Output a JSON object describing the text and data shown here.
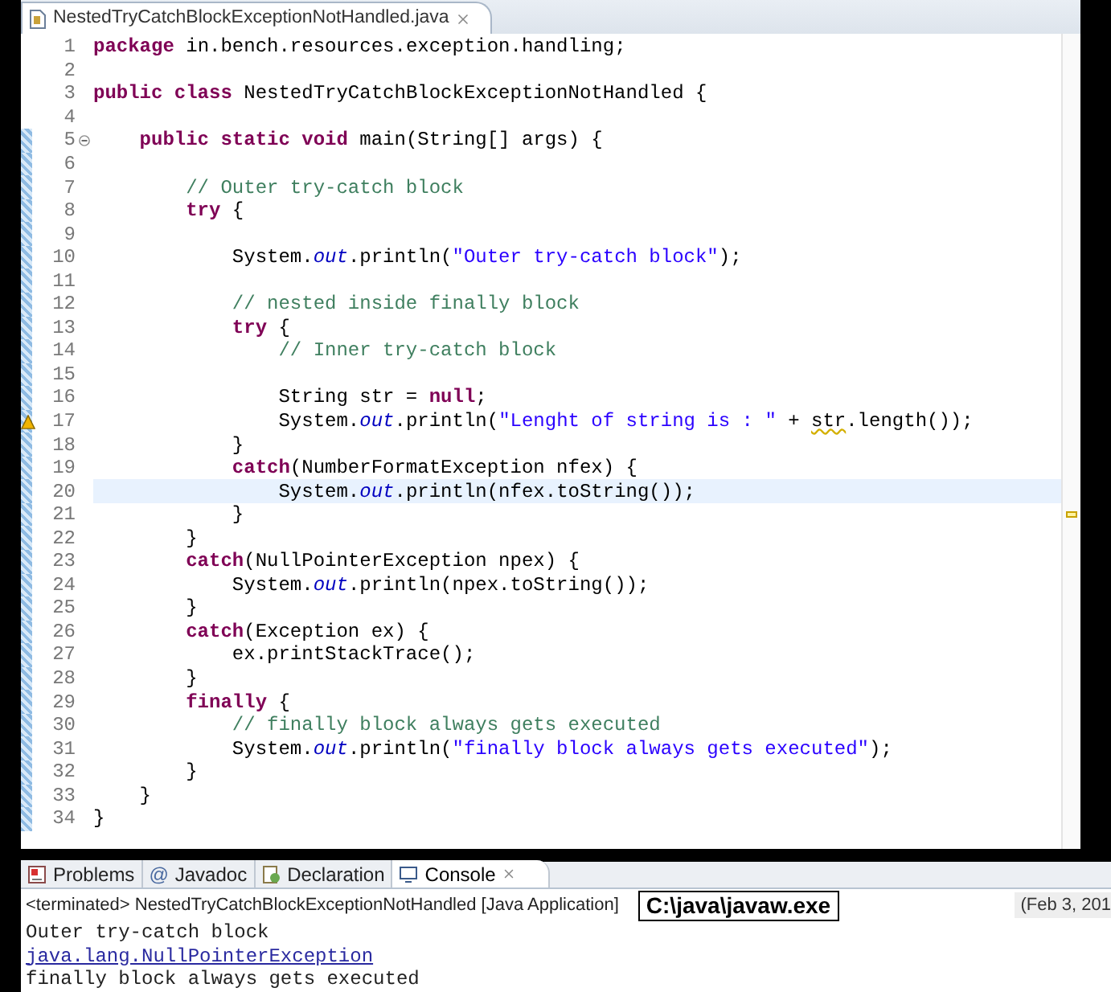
{
  "editor": {
    "tab": {
      "title": "NestedTryCatchBlockExceptionNotHandled.java"
    },
    "lines": [
      {
        "number": "1",
        "changed": false,
        "foldable": false,
        "warning": false,
        "current": false,
        "tokens": [
          {
            "kind": "keyword",
            "text": "package"
          },
          {
            "kind": "plain",
            "text": " in.bench.resources.exception.handling;"
          }
        ]
      },
      {
        "number": "2",
        "changed": false,
        "foldable": false,
        "warning": false,
        "current": false
      },
      {
        "number": "3",
        "changed": false,
        "foldable": false,
        "warning": false,
        "current": false,
        "tokens": [
          {
            "kind": "keyword",
            "text": "public class"
          },
          {
            "kind": "plain",
            "text": " NestedTryCatchBlockExceptionNotHandled {"
          }
        ]
      },
      {
        "number": "4",
        "changed": false,
        "foldable": false,
        "warning": false,
        "current": false
      },
      {
        "number": "5",
        "changed": true,
        "foldable": true,
        "warning": false,
        "current": false,
        "tokens": [
          {
            "kind": "keyword",
            "text": "    public static void"
          },
          {
            "kind": "plain",
            "text": " main(String[] args) {"
          }
        ]
      },
      {
        "number": "6",
        "changed": true,
        "foldable": false,
        "warning": false,
        "current": false
      },
      {
        "number": "7",
        "changed": true,
        "foldable": false,
        "warning": false,
        "current": false,
        "tokens": [
          {
            "kind": "comment",
            "text": "        // Outer try-catch block"
          }
        ]
      },
      {
        "number": "8",
        "changed": true,
        "foldable": false,
        "warning": false,
        "current": false,
        "tokens": [
          {
            "kind": "keyword",
            "text": "        try"
          },
          {
            "kind": "plain",
            "text": " {"
          }
        ]
      },
      {
        "number": "9",
        "changed": true,
        "foldable": false,
        "warning": false,
        "current": false
      },
      {
        "number": "10",
        "changed": true,
        "foldable": false,
        "warning": false,
        "current": false,
        "tokens": [
          {
            "kind": "plain",
            "text": "            System."
          },
          {
            "kind": "field",
            "text": "out"
          },
          {
            "kind": "plain",
            "text": ".println("
          },
          {
            "kind": "string",
            "text": "\"Outer try-catch block\""
          },
          {
            "kind": "plain",
            "text": ");"
          }
        ]
      },
      {
        "number": "11",
        "changed": true,
        "foldable": false,
        "warning": false,
        "current": false
      },
      {
        "number": "12",
        "changed": true,
        "foldable": false,
        "warning": false,
        "current": false,
        "tokens": [
          {
            "kind": "comment",
            "text": "            // nested inside finally block"
          }
        ]
      },
      {
        "number": "13",
        "changed": true,
        "foldable": false,
        "warning": false,
        "current": false,
        "tokens": [
          {
            "kind": "keyword",
            "text": "            try"
          },
          {
            "kind": "plain",
            "text": " {"
          }
        ]
      },
      {
        "number": "14",
        "changed": true,
        "foldable": false,
        "warning": false,
        "current": false,
        "tokens": [
          {
            "kind": "comment",
            "text": "                // Inner try-catch block"
          }
        ]
      },
      {
        "number": "15",
        "changed": true,
        "foldable": false,
        "warning": false,
        "current": false
      },
      {
        "number": "16",
        "changed": true,
        "foldable": false,
        "warning": false,
        "current": false,
        "tokens": [
          {
            "kind": "plain",
            "text": "                String str = "
          },
          {
            "kind": "keyword",
            "text": "null"
          },
          {
            "kind": "plain",
            "text": ";"
          }
        ]
      },
      {
        "number": "17",
        "changed": true,
        "foldable": false,
        "warning": true,
        "current": false,
        "tokens": [
          {
            "kind": "plain",
            "text": "                System."
          },
          {
            "kind": "field",
            "text": "out"
          },
          {
            "kind": "plain",
            "text": ".println("
          },
          {
            "kind": "string",
            "text": "\"Lenght of string is : \""
          },
          {
            "kind": "plain",
            "text": " + "
          },
          {
            "kind": "squiggly",
            "text": "str"
          },
          {
            "kind": "plain",
            "text": ".length());"
          }
        ]
      },
      {
        "number": "18",
        "changed": true,
        "foldable": false,
        "warning": false,
        "current": false,
        "tokens": [
          {
            "kind": "plain",
            "text": "            }"
          }
        ]
      },
      {
        "number": "19",
        "changed": true,
        "foldable": false,
        "warning": false,
        "current": false,
        "tokens": [
          {
            "kind": "keyword",
            "text": "            catch"
          },
          {
            "kind": "plain",
            "text": "(NumberFormatException nfex) {"
          }
        ]
      },
      {
        "number": "20",
        "changed": true,
        "foldable": false,
        "warning": false,
        "current": true,
        "tokens": [
          {
            "kind": "plain",
            "text": "                System."
          },
          {
            "kind": "field",
            "text": "out"
          },
          {
            "kind": "plain",
            "text": ".println(nfex.toString());"
          }
        ]
      },
      {
        "number": "21",
        "changed": true,
        "foldable": false,
        "warning": false,
        "current": false,
        "tokens": [
          {
            "kind": "plain",
            "text": "            }"
          }
        ]
      },
      {
        "number": "22",
        "changed": true,
        "foldable": false,
        "warning": false,
        "current": false,
        "tokens": [
          {
            "kind": "plain",
            "text": "        }"
          }
        ]
      },
      {
        "number": "23",
        "changed": true,
        "foldable": false,
        "warning": false,
        "current": false,
        "tokens": [
          {
            "kind": "keyword",
            "text": "        catch"
          },
          {
            "kind": "plain",
            "text": "(NullPointerException npex) {"
          }
        ]
      },
      {
        "number": "24",
        "changed": true,
        "foldable": false,
        "warning": false,
        "current": false,
        "tokens": [
          {
            "kind": "plain",
            "text": "            System."
          },
          {
            "kind": "field",
            "text": "out"
          },
          {
            "kind": "plain",
            "text": ".println(npex.toString());"
          }
        ]
      },
      {
        "number": "25",
        "changed": true,
        "foldable": false,
        "warning": false,
        "current": false,
        "tokens": [
          {
            "kind": "plain",
            "text": "        }"
          }
        ]
      },
      {
        "number": "26",
        "changed": true,
        "foldable": false,
        "warning": false,
        "current": false,
        "tokens": [
          {
            "kind": "keyword",
            "text": "        catch"
          },
          {
            "kind": "plain",
            "text": "(Exception ex) {"
          }
        ]
      },
      {
        "number": "27",
        "changed": true,
        "foldable": false,
        "warning": false,
        "current": false,
        "tokens": [
          {
            "kind": "plain",
            "text": "            ex.printStackTrace();"
          }
        ]
      },
      {
        "number": "28",
        "changed": true,
        "foldable": false,
        "warning": false,
        "current": false,
        "tokens": [
          {
            "kind": "plain",
            "text": "        }"
          }
        ]
      },
      {
        "number": "29",
        "changed": true,
        "foldable": false,
        "warning": false,
        "current": false,
        "tokens": [
          {
            "kind": "keyword",
            "text": "        finally"
          },
          {
            "kind": "plain",
            "text": " {"
          }
        ]
      },
      {
        "number": "30",
        "changed": true,
        "foldable": false,
        "warning": false,
        "current": false,
        "tokens": [
          {
            "kind": "comment",
            "text": "            // finally block always gets executed"
          }
        ]
      },
      {
        "number": "31",
        "changed": true,
        "foldable": false,
        "warning": false,
        "current": false,
        "tokens": [
          {
            "kind": "plain",
            "text": "            System."
          },
          {
            "kind": "field",
            "text": "out"
          },
          {
            "kind": "plain",
            "text": ".println("
          },
          {
            "kind": "string",
            "text": "\"finally block always gets executed\""
          },
          {
            "kind": "plain",
            "text": ");"
          }
        ]
      },
      {
        "number": "32",
        "changed": true,
        "foldable": false,
        "warning": false,
        "current": false,
        "tokens": [
          {
            "kind": "plain",
            "text": "        }"
          }
        ]
      },
      {
        "number": "33",
        "changed": true,
        "foldable": false,
        "warning": false,
        "current": false,
        "tokens": [
          {
            "kind": "plain",
            "text": "    }"
          }
        ]
      },
      {
        "number": "34",
        "changed": true,
        "foldable": false,
        "warning": false,
        "current": false,
        "tokens": [
          {
            "kind": "plain",
            "text": "}"
          }
        ]
      }
    ]
  },
  "console": {
    "tabs": [
      {
        "label": "Problems",
        "kind": "problems",
        "selected": false
      },
      {
        "label": "Javadoc",
        "kind": "javadoc",
        "icon": "@",
        "selected": false
      },
      {
        "label": "Declaration",
        "kind": "declaration",
        "selected": false
      },
      {
        "label": "Console",
        "kind": "console",
        "selected": true
      }
    ],
    "header": "<terminated> NestedTryCatchBlockExceptionNotHandled [Java Application]",
    "path_label": "C:\\java\\javaw.exe",
    "date": "(Feb 3, 201",
    "output": [
      {
        "kind": "plain",
        "text": "Outer try-catch block"
      },
      {
        "kind": "link",
        "text": "java.lang.NullPointerException"
      },
      {
        "kind": "plain",
        "text": "finally block always gets executed"
      }
    ]
  }
}
